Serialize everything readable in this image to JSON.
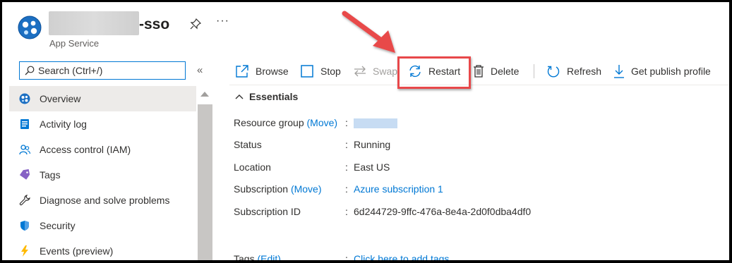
{
  "header": {
    "title_suffix": "-sso",
    "subtitle": "App Service",
    "more_label": "···"
  },
  "search": {
    "placeholder": "Search (Ctrl+/)",
    "collapse_label": "«"
  },
  "sidebar": {
    "items": [
      {
        "label": "Overview",
        "icon": "app-service-icon"
      },
      {
        "label": "Activity log",
        "icon": "activity-log-icon"
      },
      {
        "label": "Access control (IAM)",
        "icon": "people-icon"
      },
      {
        "label": "Tags",
        "icon": "tag-icon"
      },
      {
        "label": "Diagnose and solve problems",
        "icon": "wrench-icon"
      },
      {
        "label": "Security",
        "icon": "shield-icon"
      },
      {
        "label": "Events (preview)",
        "icon": "lightning-icon"
      }
    ]
  },
  "toolbar": {
    "browse": "Browse",
    "stop": "Stop",
    "swap": "Swap",
    "restart": "Restart",
    "delete": "Delete",
    "refresh": "Refresh",
    "publish": "Get publish profile"
  },
  "essentials": {
    "heading": "Essentials",
    "rows": [
      {
        "label": "Resource group",
        "link": "(Move)",
        "value": ""
      },
      {
        "label": "Status",
        "value": "Running"
      },
      {
        "label": "Location",
        "value": "East US"
      },
      {
        "label": "Subscription",
        "link": "(Move)",
        "value": "Azure subscription 1"
      },
      {
        "label": "Subscription ID",
        "value": "6d244729-9ffc-476a-8e4a-2d0f0dba4df0"
      },
      {
        "label": "Tags",
        "link": "(Edit)",
        "value": "Click here to add tags"
      }
    ]
  },
  "colors": {
    "accent": "#0078d4",
    "highlight": "#e8484a"
  }
}
